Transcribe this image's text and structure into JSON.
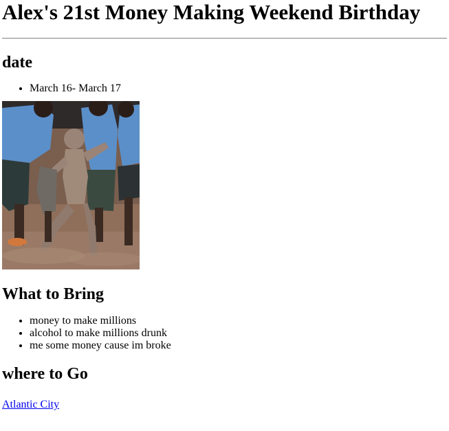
{
  "page": {
    "title": "Alex's 21st Money Making Weekend Birthday"
  },
  "date_section": {
    "heading": "date",
    "items": [
      "March 16- March 17"
    ]
  },
  "image": {
    "alt": "",
    "colors": {
      "ground": "#8a6f5c",
      "shirts": "#5b8fc9",
      "skin": "#3a2a22",
      "dust": "#a08a7a"
    }
  },
  "bring_section": {
    "heading": "What to Bring",
    "items": [
      "money to make millions",
      "alcohol to make millions drunk",
      "me some money cause im broke"
    ]
  },
  "where_section": {
    "heading": "where to Go",
    "link_text": "Atlantic City"
  },
  "colors": {
    "link": "#0000ee",
    "text": "#000000",
    "rule": "#8a8a8a"
  }
}
